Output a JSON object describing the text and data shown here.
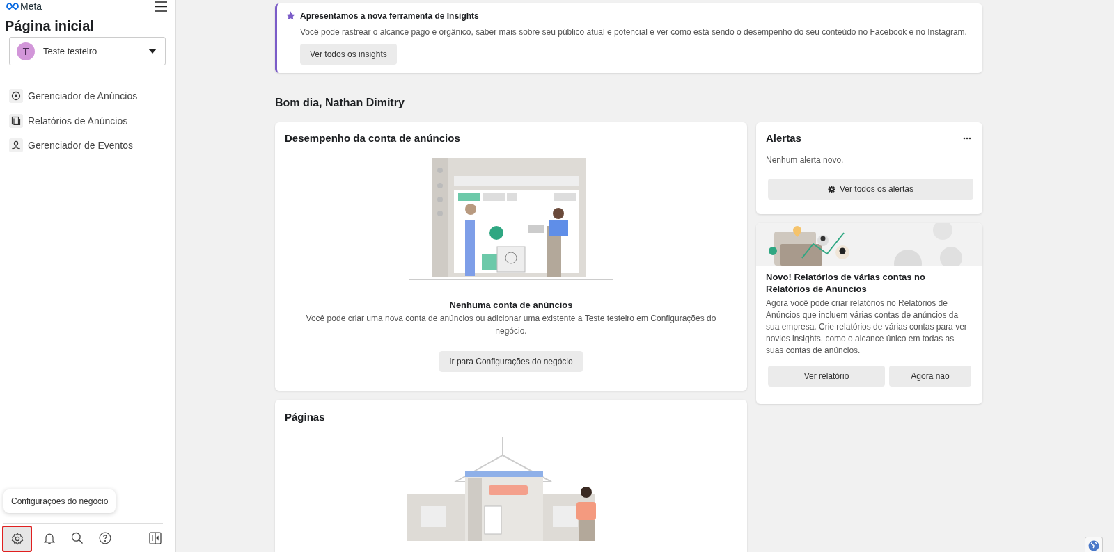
{
  "sidebar": {
    "logo": "Meta",
    "title": "Página inicial",
    "account": {
      "initial": "T",
      "name": "Teste testeiro"
    },
    "items": [
      {
        "kind": "ads-manager",
        "label": "Gerenciador de Anúncios"
      },
      {
        "kind": "ads-reporting",
        "label": "Relatórios de Anúncios"
      },
      {
        "kind": "events-manager",
        "label": "Gerenciador de Eventos"
      }
    ],
    "tooltip": "Configurações do negócio",
    "bottom_icons": [
      {
        "kind": "settings",
        "highlighted": true
      },
      {
        "kind": "bell",
        "highlighted": false
      },
      {
        "kind": "search",
        "highlighted": false
      },
      {
        "kind": "help",
        "highlighted": false
      }
    ]
  },
  "banner": {
    "title": "Apresentamos a nova ferramenta de Insights",
    "text": "Você pode rastrear o alcance pago e orgânico, saber mais sobre seu público atual e potencial e ver como está sendo o desempenho do seu conteúdo no Facebook e no Instagram.",
    "button": "Ver todos os insights"
  },
  "greeting": "Bom dia, Nathan Dimitry",
  "performance": {
    "title": "Desempenho da conta de anúncios",
    "empty_title": "Nenhuma conta de anúncios",
    "empty_text": "Você pode criar uma nova conta de anúncios ou adicionar uma existente a Teste testeiro em Configurações do negócio.",
    "button": "Ir para Configurações do negócio"
  },
  "pages": {
    "title": "Páginas"
  },
  "alerts": {
    "title": "Alertas",
    "text": "Nenhum alerta novo.",
    "button": "Ver todos os alertas"
  },
  "promo": {
    "title": "Novo! Relatórios de várias contas no Relatórios de Anúncios",
    "text": "Agora você pode criar relatórios no Relatórios de Anúncios que incluem várias contas de anúncios da sua empresa. Crie relatórios de várias contas para ver novlos insights, como o alcance único em todas as suas contas de anúncios.",
    "buttons": [
      "Ver relatório",
      "Agora não"
    ]
  }
}
